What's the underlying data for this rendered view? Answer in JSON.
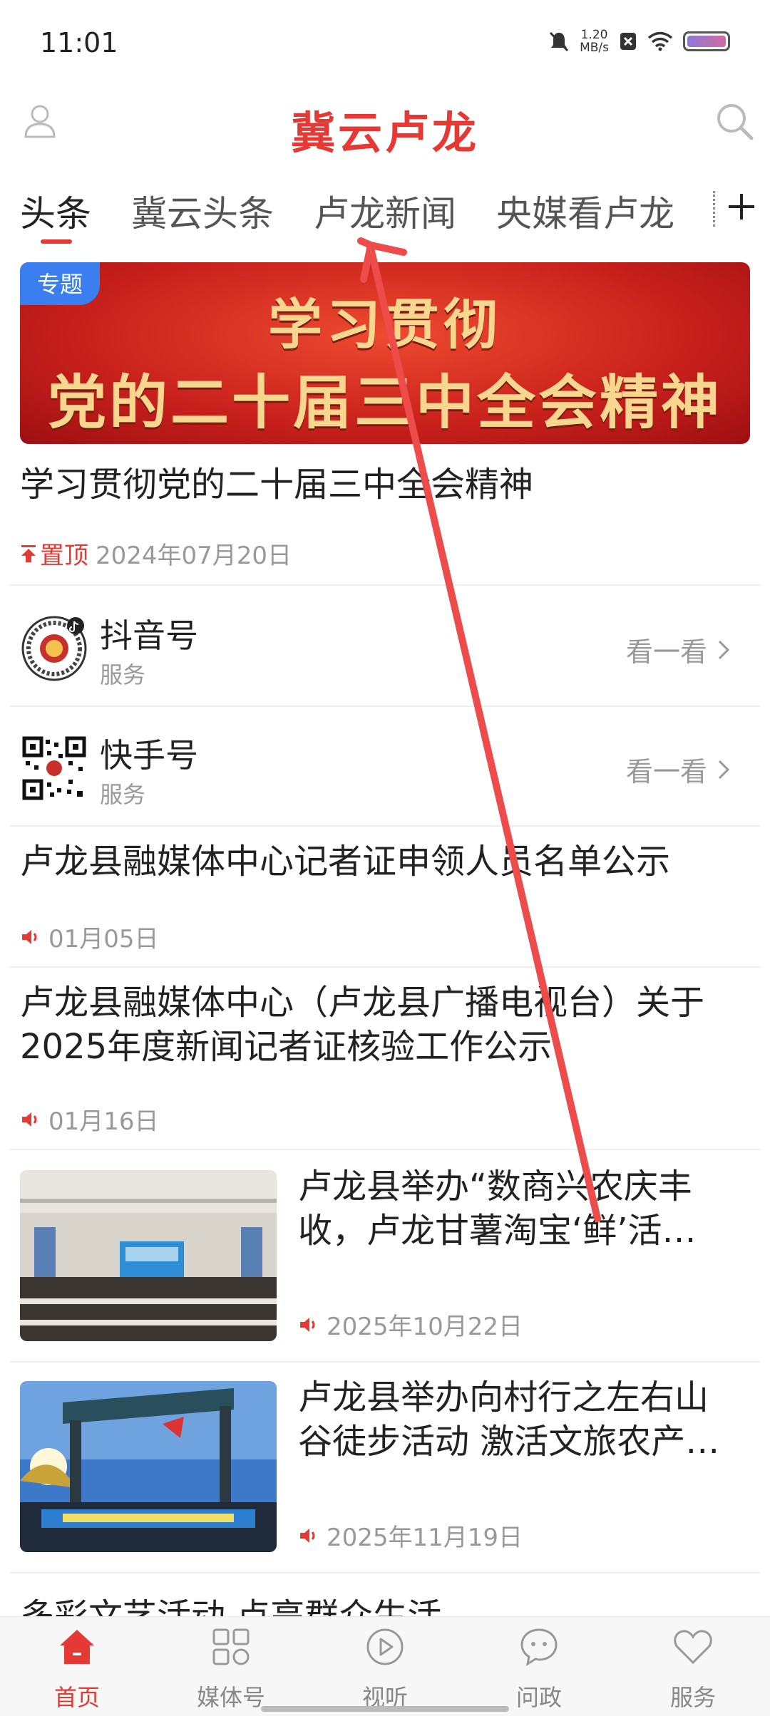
{
  "status_bar": {
    "time": "11:01",
    "net_speed_value": "1.20",
    "net_speed_unit": "MB/s"
  },
  "header": {
    "title": "冀云卢龙",
    "user_icon": "user-icon",
    "search_icon": "search-icon"
  },
  "tabs": [
    {
      "label": "头条",
      "active": true
    },
    {
      "label": "冀云头条",
      "active": false
    },
    {
      "label": "卢龙新闻",
      "active": false
    },
    {
      "label": "央媒看卢龙",
      "active": false
    }
  ],
  "banner": {
    "badge": "专题",
    "line1": "学习贯彻",
    "line2": "党的二十届三中全会精神"
  },
  "headline": {
    "title": "学习贯彻党的二十届三中全会精神",
    "pin_label": "置顶",
    "date": "2024年07月20日"
  },
  "social": [
    {
      "name": "抖音号",
      "sub": "服务",
      "action": "看一看"
    },
    {
      "name": "快手号",
      "sub": "服务",
      "action": "看一看"
    }
  ],
  "articles": [
    {
      "title": "卢龙县融媒体中心记者证申领人员名单公示",
      "date": "01月05日"
    },
    {
      "title_line1": "卢龙县融媒体中心（卢龙县广播电视台）关于",
      "title_line2": "2025年度新闻记者证核验工作公示",
      "date": "01月16日"
    }
  ],
  "image_articles": [
    {
      "title_line1": "卢龙县举办“数商兴农庆丰",
      "title_line2": "收，卢龙甘薯淘宝‘鲜’活…",
      "date": "2025年10月22日"
    },
    {
      "title_line1": "卢龙县举办向村行之左右山",
      "title_line2": "谷徒步活动 激活文旅农产…",
      "date": "2025年11月19日"
    }
  ],
  "cut_article": {
    "title": "多彩文艺活动 点亮群众生活"
  },
  "bottom_nav": [
    {
      "label": "首页",
      "active": true
    },
    {
      "label": "媒体号",
      "active": false
    },
    {
      "label": "视听",
      "active": false
    },
    {
      "label": "问政",
      "active": false
    },
    {
      "label": "服务",
      "active": false
    }
  ],
  "colors": {
    "accent": "#e53935",
    "badge_blue": "#3a7ef0",
    "muted": "#999999"
  }
}
